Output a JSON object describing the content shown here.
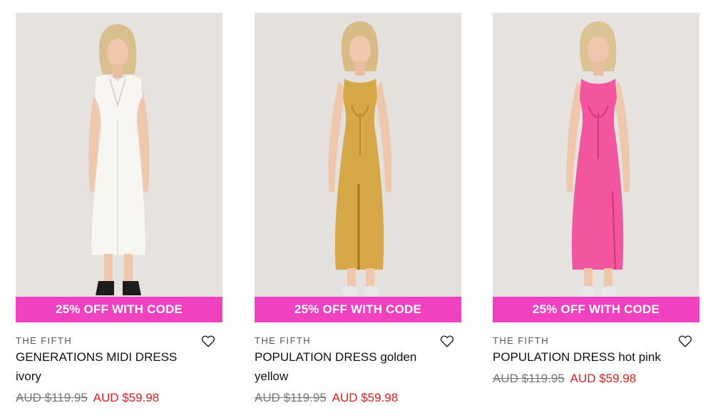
{
  "colors": {
    "promo_bg": "#f041c0",
    "sale_price": "#d81e1e",
    "photo_bg": "#e4e0dd"
  },
  "products": [
    {
      "promo": "25% OFF WITH CODE",
      "brand": "THE FIFTH",
      "name": "GENERATIONS MIDI DRESS ivory",
      "old_price": "AUD $119.95",
      "new_price": "AUD $59.98",
      "dress_color": "#f7f6f2",
      "wishlist_icon": "heart-outline-icon"
    },
    {
      "promo": "25% OFF WITH CODE",
      "brand": "THE FIFTH",
      "name": "POPULATION DRESS golden yellow",
      "old_price": "AUD $119.95",
      "new_price": "AUD $59.98",
      "dress_color": "#d6a746",
      "wishlist_icon": "heart-outline-icon"
    },
    {
      "promo": "25% OFF WITH CODE",
      "brand": "THE FIFTH",
      "name": "POPULATION DRESS hot pink",
      "old_price": "AUD $119.95",
      "new_price": "AUD $59.98",
      "dress_color": "#f2569e",
      "wishlist_icon": "heart-outline-icon"
    }
  ]
}
